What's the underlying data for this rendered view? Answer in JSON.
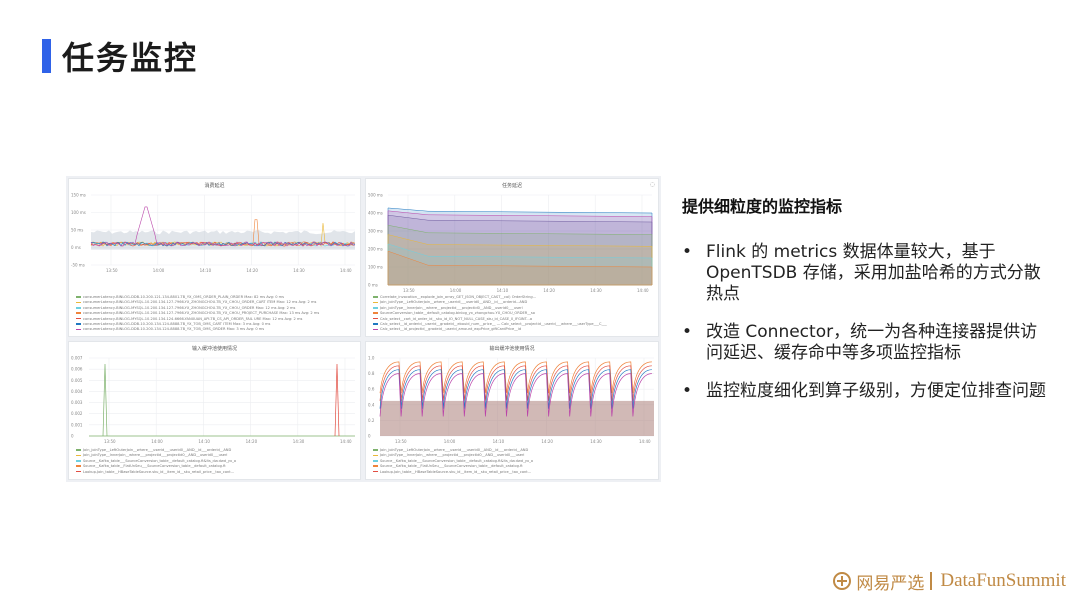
{
  "title": "任务监控",
  "right": {
    "heading": "提供细粒度的监控指标",
    "bullets": [
      "Flink 的 metrics 数据体量较大，基于 OpenTSDB 存储，采用加盐哈希的方式分散热点",
      "改造 Connector，统一为各种连接器提供访问延迟、缓存命中等多项监控指标",
      "监控粒度细化到算子级别，方便定位排查问题"
    ],
    "bullet_symbol": "•"
  },
  "dashboard": {
    "panels": [
      {
        "title": "消费延迟",
        "y_ticks": [
          "150 ms",
          "100 ms",
          "50 ms",
          "0 ms",
          "-50 ms"
        ],
        "x_ticks": [
          "13:50",
          "14:00",
          "14:10",
          "14:20",
          "14:30",
          "14:40"
        ],
        "legend": [
          "consumerLatency-BINLOG-DDB-10.200.121.134-8801-TB_YX_OMS_ORDER_PLAIN_ORDER  Max: 82 ms  Avg: 0 ms",
          "consumerLatency-BINLOG-MYSQL-10.200.134.127-7966-YX_ZHONGCHOU-TB_YX_CHOU_ORDER_CART ITEM  Max: 12 ms  Avg: 2 ms",
          "consumerLatency-BINLOG-MYSQL-10.200.134.127-7966-YX_ZHONGCHOU-TB_YX_CHOU_ORDER  Max: 12 ms  Avg: 2 ms",
          "consumerLatency-BINLOG-MYSQL-10.200.134.127-7966-YX_ZHONGCHOU-TB_YX_CHOU_PROJECT_PURCHASE  Max: 13 ms  Avg: 2 ms",
          "consumerLatency-BINLOG-MYSQL-10.200.134.124-6666-YANXUAN_API-TB_CS_API_ORDER_FAIL URE  Max: 12 ms  Avg: 2 ms",
          "consumerLatency-BINLOG-DDB-10.200.134.124-8888-TB_YX_TOB_OMS_CART ITEM  Max: 3 ms  Avg: 0 ms",
          "consumerLatency-BINLOG-DDB-10.200.134.124-8888-TB_YX_TOB_OMS_ORDER  Max: 3 ms  Avg: 0 ms"
        ]
      },
      {
        "title": "任务延迟",
        "y_ticks": [
          "500 ms",
          "400 ms",
          "300 ms",
          "200 ms",
          "100 ms",
          "0 ms"
        ],
        "x_ticks": [
          "13:50",
          "14:00",
          "14:10",
          "14:20",
          "14:30",
          "14:40"
        ],
        "legend": [
          "Correlate_invocation__explode_join_array_GET_JSON_OBJECT_CAST__col) OrderString...",
          "Join_joinType__LeftOuterJoin__where__useridl___userid0__AND__id___orderid...AND",
          "Join_joinType__InnerJoin__where__projectid___projectid0__AND__userid0___userl",
          "SourceConversion_table__default_catalog.binlog_yx_zhongchou.YX_CHOU_ORDER__so",
          "Calc_select__cart_id_order_id__sku_id_IO_NOT_NULL_CASE_sku_id_CASE_0_IFGINT...a",
          "Calc_select__id_orderid__userid__gradeid__ebouid_num__price__  —  Calc_select__projectid__userid___where___userType___C___",
          "Calc_select__id_projectid__gradeid__userid_amount_expPrice_giftCardPrice__id"
        ]
      },
      {
        "title": "输入缓冲池使用情况",
        "y_ticks": [
          "0.007",
          "0.006",
          "0.005",
          "0.004",
          "0.003",
          "0.002",
          "0.001",
          "0"
        ],
        "x_ticks": [
          "13:50",
          "14:00",
          "14:10",
          "14:20",
          "14:30",
          "14:40"
        ],
        "legend": [
          "Join_joinType__LeftOuterJoin__where___userid___userid0__AND__id___orderid__AND",
          "Join_joinType__InnerJoin__where___projectid___projectid0__AND__userid0___userl",
          "Source__Kafka_table___SourceConversion_table__default_catalog.ft&its_dw.dwd_yx_o",
          "Source__Kafka_table__FlatUnSeu___SourceConversion_table__default_catalog.ft",
          "Lookup.Join_table__HBaseTableSource.sku_id__item_id__sku_retail_price__tax_cont..."
        ]
      },
      {
        "title": "输出缓冲池使用情况",
        "y_ticks": [
          "1.0",
          "0.8",
          "0.6",
          "0.4",
          "0.2",
          "0"
        ],
        "x_ticks": [
          "13:50",
          "14:00",
          "14:10",
          "14:20",
          "14:30",
          "14:40"
        ],
        "legend": [
          "Join_joinType__LeftOuterJoin__where___userid___userid0__AND__id___orderid__AND",
          "Join_joinType__InnerJoin__where___projectid___projectid0__AND__userid0___userl",
          "Source__Kafka_table___SourceConversion_table__default_catalog.ft&its_dw.dwd_yx_o",
          "Source__Kafka_table__FlatUnSeu___SourceConversion_table__default_catalog.ft",
          "Lookup.Join_table__HBaseTableSource.sku_id__item_id__sku_retail_price__tax_cont..."
        ]
      }
    ],
    "series_colors": [
      "#7eb26d",
      "#eab839",
      "#6ed0e0",
      "#ef843c",
      "#e24d42",
      "#1f78c1",
      "#ba43a9",
      "#705da0"
    ]
  },
  "brand": {
    "cn": "网易严选",
    "en": "DataFunSummit"
  }
}
